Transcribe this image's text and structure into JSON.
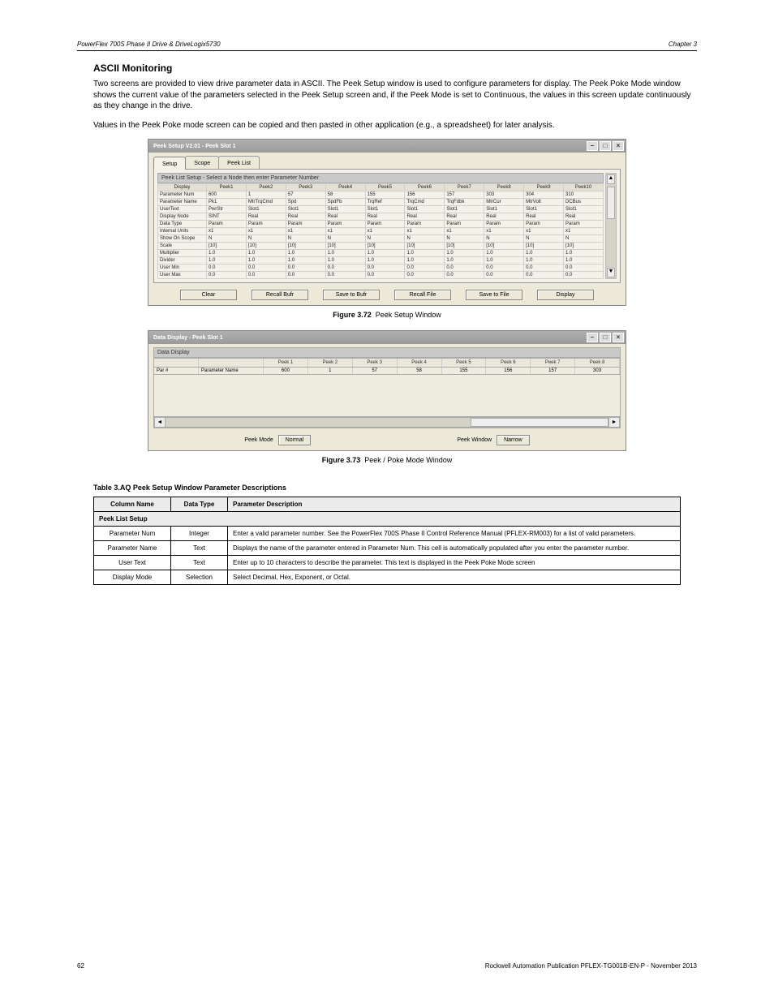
{
  "header": {
    "left": "PowerFlex 700S Phase II Drive & DriveLogix5730",
    "right": "Chapter 3"
  },
  "section": {
    "title": "ASCII Monitoring",
    "p1": "Two screens are provided to view drive parameter data in ASCII. The Peek Setup window is used to configure parameters for display. The Peek Poke Mode window shows the current value of the parameters selected in the Peek Setup screen and, if the Peek Mode is set to Continuous, the values in this screen update continuously as they change in the drive.",
    "p2": "Values in the Peek Poke mode screen can be copied and then pasted in other application (e.g., a spreadsheet) for later analysis."
  },
  "win1": {
    "title": "Peek Setup V2.01 - Peek Slot 1",
    "tabs": [
      "Setup",
      "Scope",
      "Peek List"
    ],
    "group_header": "Peek List Setup - Select a Node then enter Parameter Number",
    "columns": [
      "Display",
      "Peek1",
      "Peek2",
      "Peek3",
      "Peek4",
      "Peek5",
      "Peek6",
      "Peek7",
      "Peek8",
      "Peek9",
      "Peek10"
    ],
    "rows": [
      {
        "label": "Parameter Num",
        "vals": [
          "600",
          "1",
          "57",
          "58",
          "155",
          "156",
          "157",
          "303",
          "304",
          "310"
        ]
      },
      {
        "label": "Parameter Name",
        "vals": [
          "Pk1",
          "MtrTrqCmd",
          "Spd",
          "SpdFb",
          "TrqRef",
          "TrqCmd",
          "TrqFdbk",
          "MtrCur",
          "MtrVolt",
          "DCBus"
        ]
      },
      {
        "label": "UserText",
        "vals": [
          "PwrStr",
          "Slot1",
          "Slot1",
          "Slot1",
          "Slot1",
          "Slot1",
          "Slot1",
          "Slot1",
          "Slot1",
          "Slot1"
        ]
      },
      {
        "label": "Display Node",
        "vals": [
          "SINT",
          "Real",
          "Real",
          "Real",
          "Real",
          "Real",
          "Real",
          "Real",
          "Real",
          "Real"
        ]
      },
      {
        "label": "Data Type",
        "vals": [
          "Param",
          "Param",
          "Param",
          "Param",
          "Param",
          "Param",
          "Param",
          "Param",
          "Param",
          "Param"
        ]
      },
      {
        "label": "Internal Units",
        "vals": [
          "x1",
          "x1",
          "x1",
          "x1",
          "x1",
          "x1",
          "x1",
          "x1",
          "x1",
          "x1"
        ]
      },
      {
        "label": "Show On Scope",
        "vals": [
          "N",
          "N",
          "N",
          "N",
          "N",
          "N",
          "N",
          "N",
          "N",
          "N"
        ]
      },
      {
        "label": "Scale",
        "vals": [
          "[10]",
          "[10]",
          "[10]",
          "[10]",
          "[10]",
          "[10]",
          "[10]",
          "[10]",
          "[10]",
          "[10]"
        ]
      },
      {
        "label": "Multiplier",
        "vals": [
          "1.0",
          "1.0",
          "1.0",
          "1.0",
          "1.0",
          "1.0",
          "1.0",
          "1.0",
          "1.0",
          "1.0"
        ]
      },
      {
        "label": "Divider",
        "vals": [
          "1.0",
          "1.0",
          "1.0",
          "1.0",
          "1.0",
          "1.0",
          "1.0",
          "1.0",
          "1.0",
          "1.0"
        ]
      },
      {
        "label": "User Min",
        "vals": [
          "0.0",
          "0.0",
          "0.0",
          "0.0",
          "0.0",
          "0.0",
          "0.0",
          "0.0",
          "0.0",
          "0.0"
        ]
      },
      {
        "label": "User Max",
        "vals": [
          "0.0",
          "0.0",
          "0.0",
          "0.0",
          "0.0",
          "0.0",
          "0.0",
          "0.0",
          "0.0",
          "0.0"
        ]
      }
    ],
    "buttons": [
      "Clear",
      "Recall Bufr",
      "Save to Bufr",
      "Recall File",
      "Save to File",
      "Display"
    ]
  },
  "fig1": "Figure 3.72 Peek Setup Window",
  "win2": {
    "title": "Data Display - Peek Slot 1",
    "group_header": "Data Display",
    "head": [
      "",
      "",
      "Peek 1",
      "Peek 2",
      "Peek 3",
      "Peek 4",
      "Peek 5",
      "Peek 6",
      "Peek 7",
      "Peek 8"
    ],
    "row_label0": "Par #",
    "row_label1": "Parameter Name",
    "row_vals": [
      "600",
      "1",
      "57",
      "58",
      "155",
      "156",
      "157",
      "303"
    ],
    "mode_label": "Peek Mode",
    "mode_button": "Normal",
    "window_label": "Peek Window",
    "window_button": "Narrow"
  },
  "fig2": "Figure 3.73 Peek / Poke Mode Window",
  "param_table": {
    "title": "Table 3.AQ Peek Setup Window Parameter Descriptions",
    "headers": [
      "Column Name",
      "Data Type",
      "Parameter Description"
    ],
    "section": "Peek List Setup",
    "rows": [
      {
        "col": "Parameter Num",
        "type": "Integer",
        "desc": "Enter a valid parameter number. See the PowerFlex 700S Phase II Control Reference Manual (PFLEX-RM003) for a list of valid parameters."
      },
      {
        "col": "Parameter Name",
        "type": "Text",
        "desc": "Displays the name of the parameter entered in Parameter Num. This cell is automatically populated after you enter the parameter number."
      },
      {
        "col": "User Text",
        "type": "Text",
        "desc": "Enter up to 10 characters to describe the parameter. This text is displayed in the Peek Poke Mode screen"
      },
      {
        "col": "Display Mode",
        "type": "Selection",
        "desc": "Select Decimal, Hex, Exponent, or Octal."
      }
    ]
  },
  "footer": {
    "left": "62",
    "right": "Rockwell Automation Publication PFLEX-TG001B-EN-P - November 2013"
  }
}
